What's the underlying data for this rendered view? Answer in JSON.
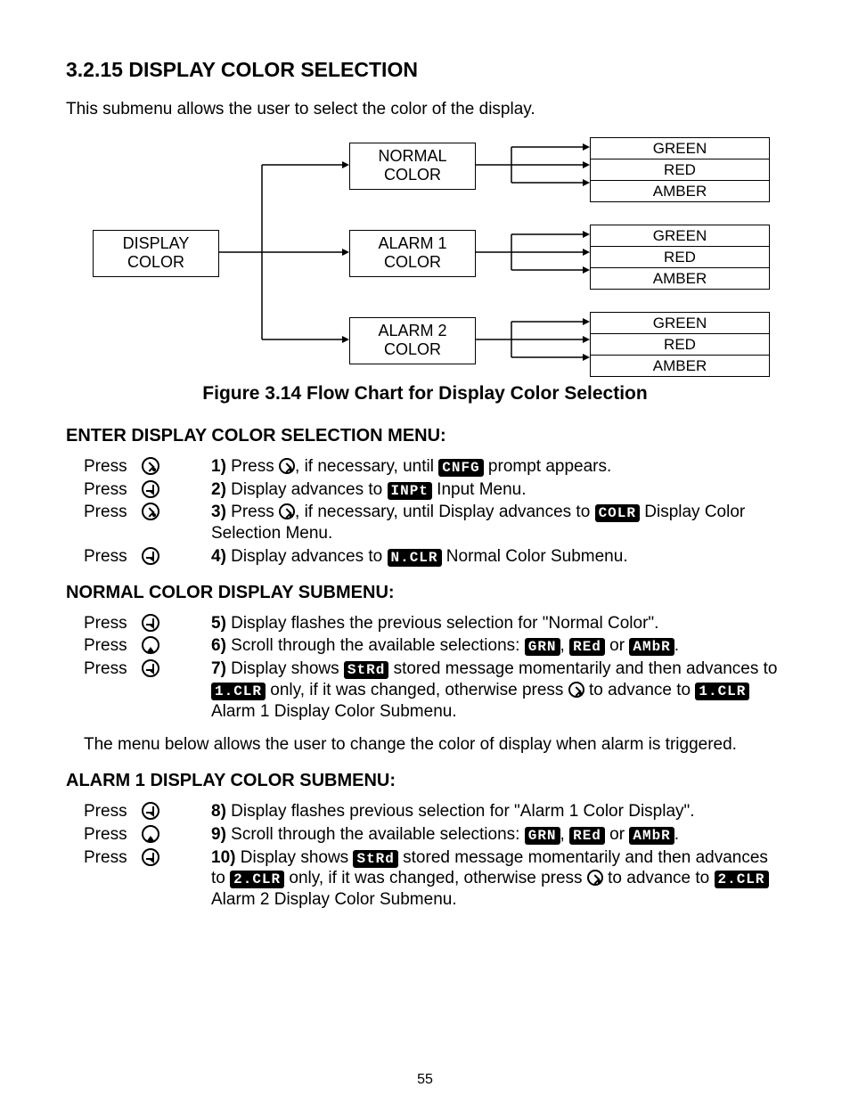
{
  "title": "3.2.15 DISPLAY COLOR SELECTION",
  "intro": "This submenu allows the user to select  the color of the display.",
  "diagram": {
    "root": {
      "l1": "DISPLAY",
      "l2": "COLOR"
    },
    "nodes": [
      {
        "l1": "NORMAL",
        "l2": "COLOR"
      },
      {
        "l1": "ALARM 1",
        "l2": "COLOR"
      },
      {
        "l1": "ALARM 2",
        "l2": "COLOR"
      }
    ],
    "options": [
      "GREEN",
      "RED",
      "AMBER"
    ]
  },
  "caption": "Figure 3.14 Flow Chart for Display Color Selection",
  "sect1": "ENTER DISPLAY COLOR SELECTION MENU:",
  "press": "Press",
  "s1": {
    "n": "1)",
    "a": " Press ",
    "b": ", if necessary, until ",
    "c": " prompt appears.",
    "badge": "CNFG"
  },
  "s2": {
    "n": "2)",
    "a": " Display advances to ",
    "b": " Input Menu.",
    "badge": "INPt"
  },
  "s3": {
    "n": "3)",
    "a": " Press ",
    "b": ", if necessary, until Display advances to ",
    "c": " Display Color Selection Menu.",
    "badge": "COLR"
  },
  "s4": {
    "n": "4)",
    "a": " Display advances to ",
    "b": " Normal Color Submenu.",
    "badge": "N.CLR"
  },
  "sect2": "NORMAL COLOR DISPLAY SUBMENU:",
  "s5": {
    "n": "5)",
    "a": " Display flashes the previous selection for \"Normal Color\"."
  },
  "s6": {
    "n": "6)",
    "a": " Scroll through the available selections: ",
    "b": ", ",
    "c": " or ",
    "d": ".",
    "g": "GRN",
    "r": "REd",
    "am": "AMbR"
  },
  "s7": {
    "n": "7)",
    "a": " Display shows ",
    "b": " stored message momentarily and then advances to ",
    "c": " only, if it was changed, otherwise press ",
    "d": " to advance to ",
    "e": " Alarm 1 Display Color Submenu.",
    "strd": "StRd",
    "one": "1.CLR"
  },
  "para": "The menu below allows the user to change the color of display when alarm is triggered.",
  "sect3": "ALARM 1 DISPLAY COLOR SUBMENU:",
  "s8": {
    "n": "8)",
    "a": " Display flashes previous selection for \"Alarm 1 Color Display\"."
  },
  "s9": {
    "n": "9)",
    "a": " Scroll through the available selections: ",
    "b": ", ",
    "c": " or ",
    "d": ".",
    "g": "GRN",
    "r": "REd",
    "am": "AMbR"
  },
  "s10": {
    "n": "10)",
    "a": " Display shows ",
    "b": " stored message momentarily and then advances to ",
    "c": " only, if it was changed, otherwise press ",
    "d": " to advance to ",
    "e": " Alarm 2 Display Color Submenu.",
    "strd": "StRd",
    "two": "2.CLR"
  },
  "page": "55"
}
